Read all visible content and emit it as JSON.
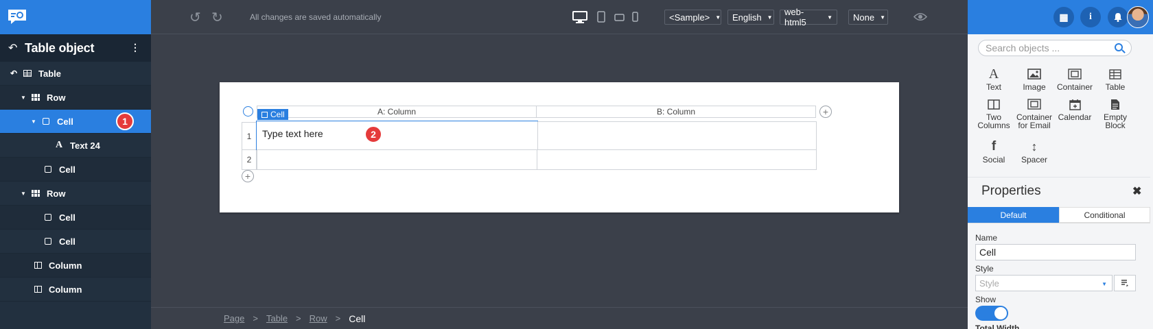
{
  "sidebar": {
    "title": "Table object",
    "items": [
      {
        "label": "Table"
      },
      {
        "label": "Row"
      },
      {
        "label": "Cell",
        "badge": "1"
      },
      {
        "label": "Text 24"
      },
      {
        "label": "Cell"
      },
      {
        "label": "Row"
      },
      {
        "label": "Cell"
      },
      {
        "label": "Cell"
      },
      {
        "label": "Column"
      },
      {
        "label": "Column"
      }
    ]
  },
  "toolbar": {
    "status": "All changes are saved automatically",
    "dropdowns": [
      "<Sample>",
      "English",
      "web-html5",
      "None"
    ]
  },
  "canvas": {
    "columns": [
      "A: Column",
      "B: Column"
    ],
    "rows": [
      "1",
      "2"
    ],
    "cell_tag": "Cell",
    "cell_text": "Type text here",
    "badge": "2"
  },
  "breadcrumb": {
    "items": [
      "Page",
      "Table",
      "Row"
    ],
    "separator": ">",
    "current": "Cell"
  },
  "right_panel": {
    "search_placeholder": "Search objects ...",
    "objects": [
      {
        "label": "Text",
        "icon": "text-icon"
      },
      {
        "label": "Image",
        "icon": "image-icon"
      },
      {
        "label": "Container",
        "icon": "container-icon"
      },
      {
        "label": "Table",
        "icon": "table-icon"
      },
      {
        "label": "Two Columns",
        "icon": "two-columns-icon"
      },
      {
        "label": "Container for Email",
        "icon": "container-email-icon"
      },
      {
        "label": "Calendar",
        "icon": "calendar-icon"
      },
      {
        "label": "Empty Block",
        "icon": "empty-block-icon"
      },
      {
        "label": "Social",
        "icon": "facebook-icon"
      },
      {
        "label": "Spacer",
        "icon": "spacer-icon"
      }
    ],
    "properties_title": "Properties",
    "tabs": [
      "Default",
      "Conditional"
    ],
    "name_label": "Name",
    "name_value": "Cell",
    "style_label": "Style",
    "style_placeholder": "Style",
    "show_label": "Show",
    "next_label": "Total Width"
  },
  "colors": {
    "accent": "#2a7fe0",
    "sidebar_bg": "#22303f",
    "canvas_bg": "#3b404a",
    "badge": "#e53b3b"
  }
}
